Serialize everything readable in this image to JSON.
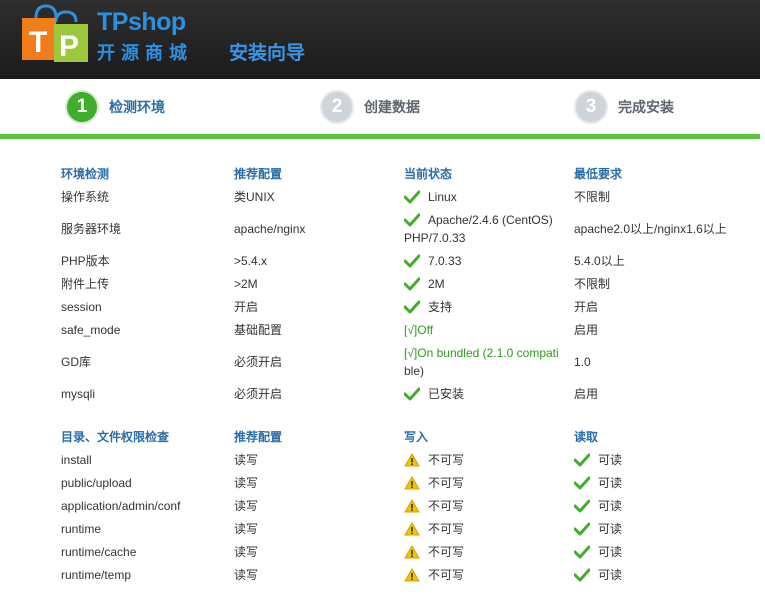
{
  "brand": {
    "name_top": "TPshop",
    "name_bottom": "开源商城"
  },
  "page_title": "安装向导",
  "steps": [
    {
      "num": "1",
      "label": "检测环境",
      "active": true
    },
    {
      "num": "2",
      "label": "创建数据",
      "active": false
    },
    {
      "num": "3",
      "label": "完成安装",
      "active": false
    }
  ],
  "env": {
    "headers": [
      "环境检测",
      "推荐配置",
      "当前状态",
      "最低要求"
    ],
    "rows": [
      {
        "name": "操作系统",
        "rec": "类UNIX",
        "cur": "Linux",
        "cur_line2": "",
        "cur_icon": "check-icon",
        "min": "不限制"
      },
      {
        "name": "服务器环境",
        "rec": "apache/nginx",
        "cur": "Apache/2.4.6 (CentOS)",
        "cur_line2": "PHP/7.0.33",
        "cur_icon": "check-icon",
        "min": "apache2.0以上/nginx1.6以上"
      },
      {
        "name": "PHP版本",
        "rec": ">5.4.x",
        "cur": "7.0.33",
        "cur_line2": "",
        "cur_icon": "check-icon",
        "min": "5.4.0以上"
      },
      {
        "name": "附件上传",
        "rec": ">2M",
        "cur": "2M",
        "cur_line2": "",
        "cur_icon": "check-icon",
        "min": "不限制"
      },
      {
        "name": "session",
        "rec": "开启",
        "cur": "支持",
        "cur_line2": "",
        "cur_icon": "check-icon",
        "min": "开启"
      },
      {
        "name": "safe_mode",
        "rec": "基础配置",
        "cur": "[√]Off",
        "cur_line2": "",
        "cur_icon": "",
        "min": "启用"
      },
      {
        "name": "GD库",
        "rec": "必须开启",
        "cur": "[√]On bundled (2.1.0 compati",
        "cur_line2": "ble)",
        "cur_icon": "",
        "min": "1.0"
      },
      {
        "name": "mysqli",
        "rec": "必须开启",
        "cur": "已安装",
        "cur_line2": "",
        "cur_icon": "check-icon",
        "min": "启用"
      }
    ]
  },
  "perm": {
    "headers": [
      "目录、文件权限检查",
      "推荐配置",
      "写入",
      "读取"
    ],
    "rows": [
      {
        "path": "install",
        "rec": "读写",
        "write": "不可写",
        "read": "可读"
      },
      {
        "path": "public/upload",
        "rec": "读写",
        "write": "不可写",
        "read": "可读"
      },
      {
        "path": "application/admin/conf",
        "rec": "读写",
        "write": "不可写",
        "read": "可读"
      },
      {
        "path": "runtime",
        "rec": "读写",
        "write": "不可写",
        "read": "可读"
      },
      {
        "path": "runtime/cache",
        "rec": "读写",
        "write": "不可写",
        "read": "可读"
      },
      {
        "path": "runtime/temp",
        "rec": "读写",
        "write": "不可写",
        "read": "可读"
      }
    ]
  },
  "colors": {
    "header_bg": "#1f1f1f",
    "accent_blue": "#2a6da8",
    "accent_green": "#3fae2a",
    "warn_yellow": "#f2c400"
  }
}
